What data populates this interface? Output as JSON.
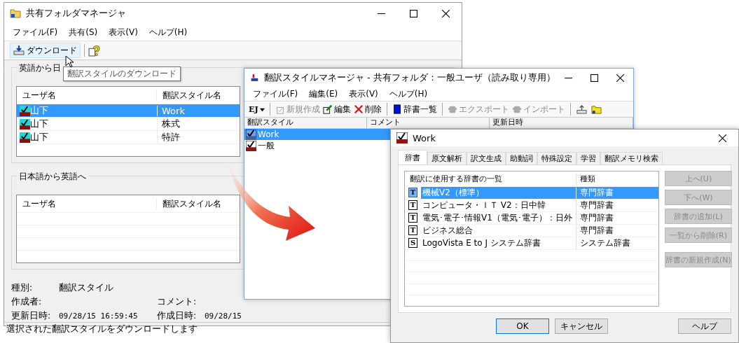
{
  "shared_folder_manager": {
    "title": "共有フォルダマネージャ",
    "menu": [
      "ファイル(F)",
      "共有(S)",
      "表示(V)",
      "ヘルプ(H)"
    ],
    "toolbar": {
      "download": "ダウンロード"
    },
    "tooltip": "翻訳スタイルのダウンロード",
    "groups": [
      {
        "title": "英語から日",
        "columns": [
          "ユーザ名",
          "翻訳スタイル名"
        ],
        "rows": [
          {
            "user": "山下",
            "style": "Work",
            "selected": true
          },
          {
            "user": "山下",
            "style": "株式",
            "selected": false
          },
          {
            "user": "山下",
            "style": "特許",
            "selected": false
          }
        ]
      },
      {
        "title": "日本語から英語へ",
        "columns": [
          "ユーザ名",
          "翻訳スタイル名"
        ]
      }
    ],
    "info": [
      {
        "label": "種別:",
        "value": "翻訳スタイル"
      },
      {
        "label": "作成者:",
        "label_2": "コメント:"
      },
      {
        "label": "更新日時:",
        "value": "09/28/15 16:59:45",
        "label_2": "作成日時:",
        "value_2": "09/28/15"
      }
    ],
    "status": "選択された翻訳スタイルをダウンロードします"
  },
  "style_manager": {
    "title": "翻訳スタイルマネージャ - 共有フォルダ：一般ユーザ（読み取り専用）",
    "menu": [
      "ファイル(F)",
      "編集(E)",
      "表示(V)",
      "ヘルプ(H)"
    ],
    "toolbar": [
      {
        "kind": "ej",
        "label": "EJ",
        "disabled": false
      },
      {
        "kind": "new",
        "label": "新規作成",
        "disabled": true
      },
      {
        "kind": "edit",
        "label": "編集",
        "disabled": false
      },
      {
        "kind": "delete",
        "label": "削除",
        "disabled": false
      },
      {
        "kind": "dictionary",
        "label": "辞書一覧",
        "disabled": false
      },
      {
        "kind": "export",
        "label": "エクスポート",
        "disabled": true
      },
      {
        "kind": "import",
        "label": "インポート",
        "disabled": true
      },
      {
        "kind": "upload",
        "disabled": false
      },
      {
        "kind": "folder",
        "disabled": false
      }
    ],
    "columns": [
      "翻訳スタイル",
      "コメント",
      "更新日時"
    ],
    "rows": [
      {
        "name": "Work",
        "selected": true
      },
      {
        "name": "一般",
        "selected": false
      }
    ]
  },
  "dialog": {
    "title": "Work",
    "tabs": [
      {
        "label": "辞書",
        "selected": true
      },
      {
        "label": "原文解析",
        "selected": false
      },
      {
        "label": "訳文生成",
        "selected": false
      },
      {
        "label": "助動詞",
        "selected": false
      },
      {
        "label": "特殊設定",
        "selected": false
      },
      {
        "label": "学習",
        "selected": false
      },
      {
        "label": "翻訳メモリ検索",
        "selected": false
      }
    ],
    "columns": [
      "翻訳に使用する辞書の一覧",
      "種類"
    ],
    "rows": [
      {
        "mark": "T",
        "name": "機械V2（標準）",
        "type": "専門辞書",
        "selected": true
      },
      {
        "mark": "T",
        "name": "コンピュータ・ＩＴ V2：日中韓",
        "type": "専門辞書",
        "selected": false
      },
      {
        "mark": "T",
        "name": "電気･電子･情報V1（電気･電子）：日外",
        "type": "専門辞書",
        "selected": false
      },
      {
        "mark": "T",
        "name": "ビジネス総合",
        "type": "専門辞書",
        "selected": false
      },
      {
        "mark": "S",
        "name": "LogoVista E to J システム辞書",
        "type": "システム辞書",
        "selected": false
      }
    ],
    "side_buttons": [
      {
        "label": "上へ(U)",
        "disabled": true
      },
      {
        "label": "下へ(W)",
        "disabled": true
      },
      {
        "label": "辞書の追加(L)",
        "disabled": true
      },
      {
        "label": "一覧から削除(R)",
        "disabled": true
      },
      {
        "label": "辞書の新規作成(N)",
        "disabled": true
      }
    ],
    "buttons": [
      {
        "label": "OK",
        "default": true
      },
      {
        "label": "キャンセル",
        "default": false
      },
      {
        "label": "ヘルプ",
        "default": false
      }
    ]
  }
}
